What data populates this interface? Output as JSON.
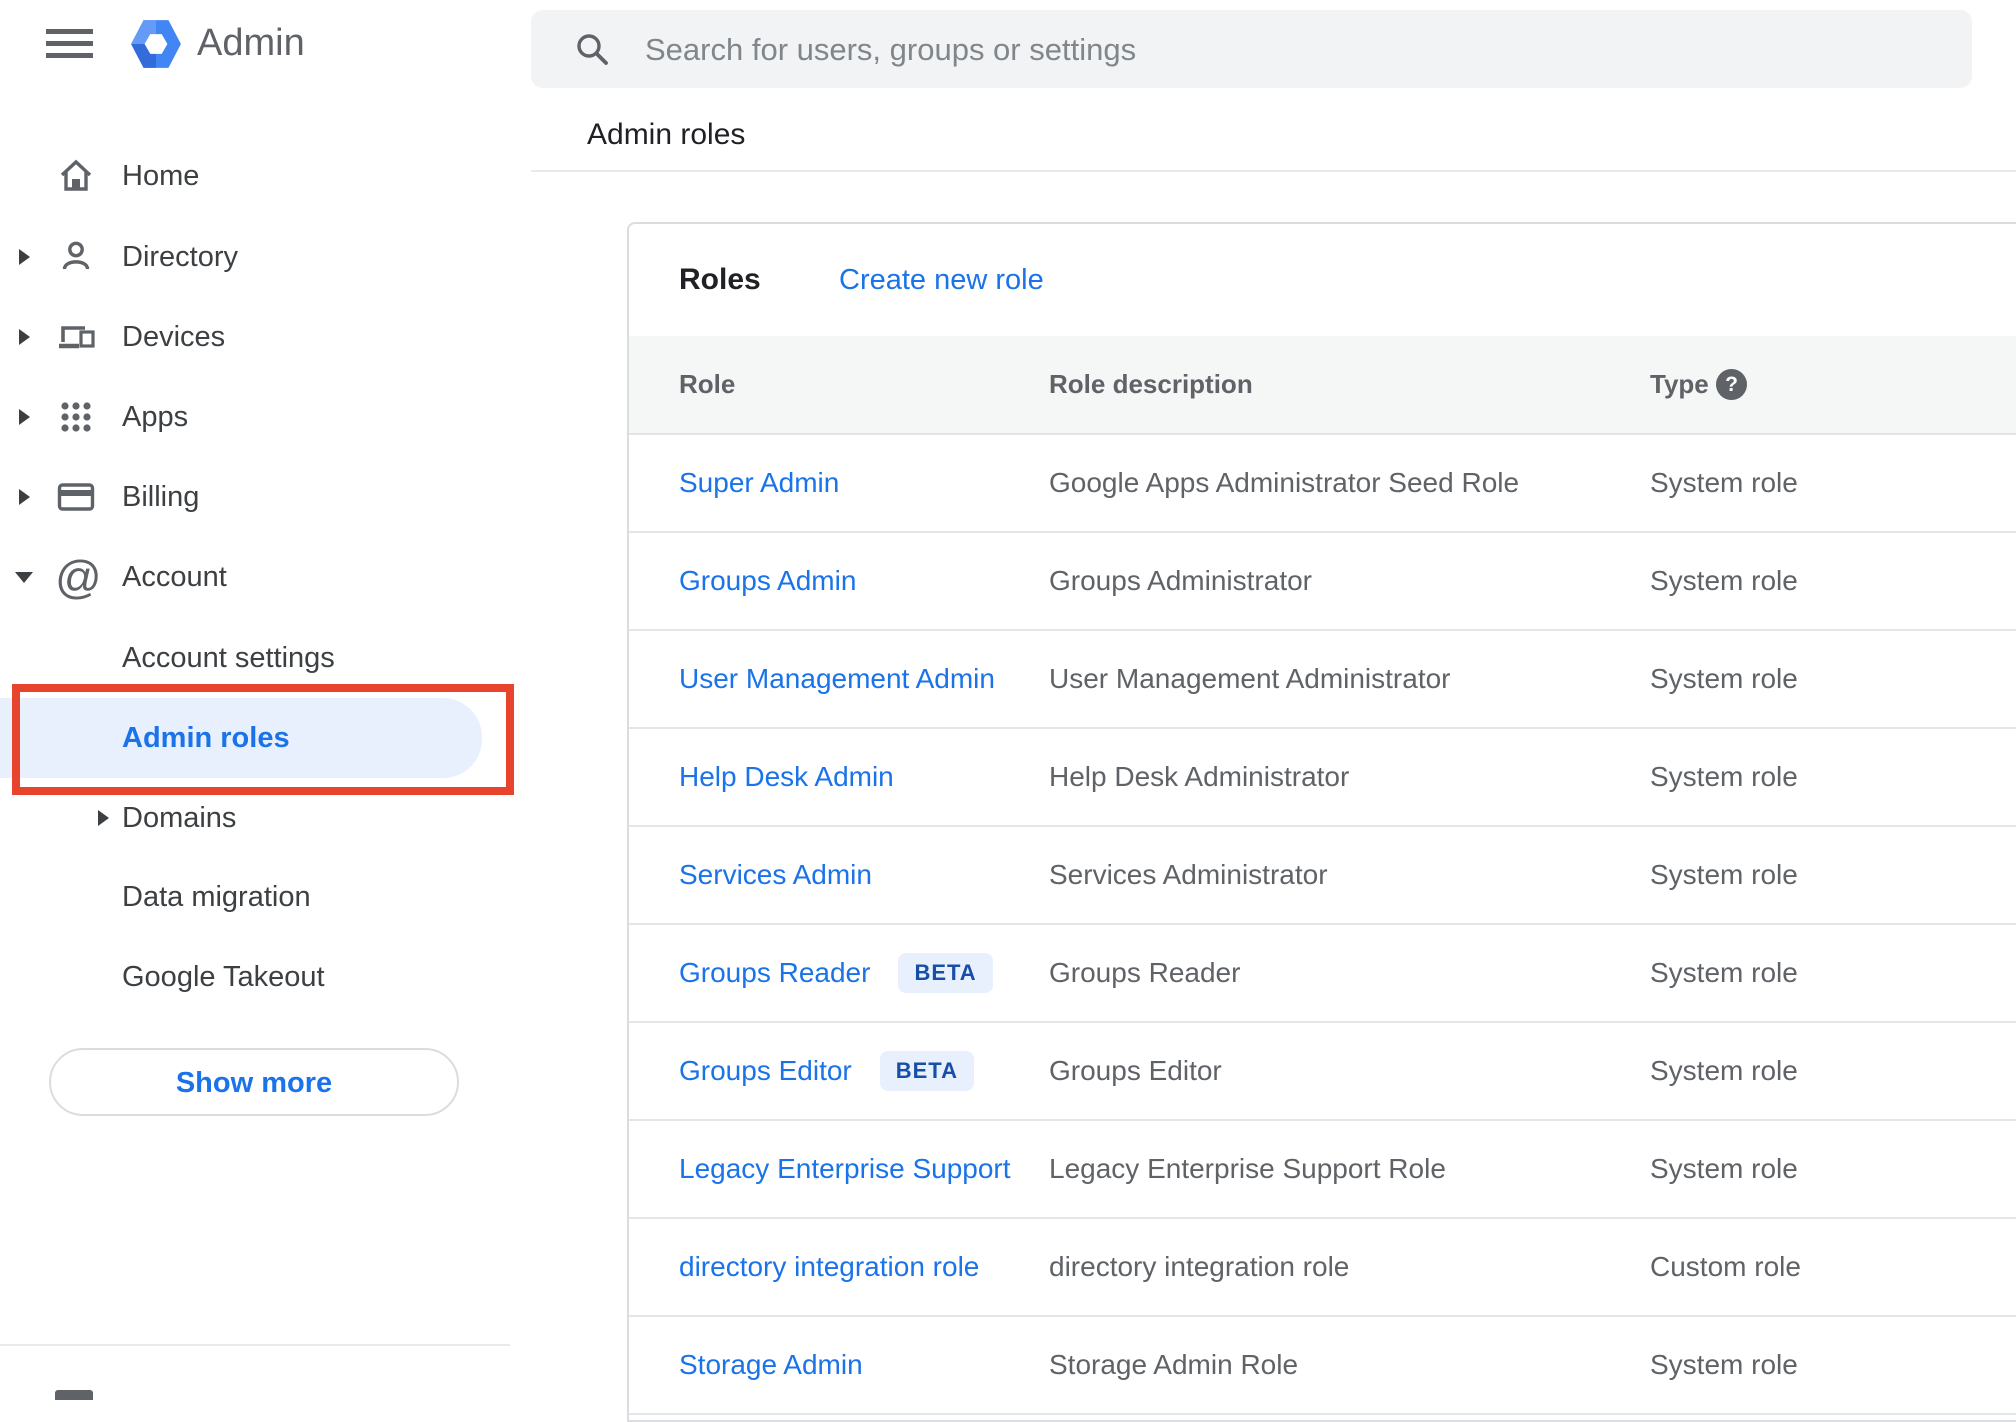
{
  "app": {
    "name": "Admin"
  },
  "search": {
    "placeholder": "Search for users, groups or settings"
  },
  "breadcrumb": "Admin roles",
  "sidebar": {
    "items": [
      {
        "label": "Home",
        "expandable": false
      },
      {
        "label": "Directory",
        "expandable": true
      },
      {
        "label": "Devices",
        "expandable": true
      },
      {
        "label": "Apps",
        "expandable": true
      },
      {
        "label": "Billing",
        "expandable": true
      },
      {
        "label": "Account",
        "expandable": true,
        "expanded": true
      }
    ],
    "account_children": [
      {
        "label": "Account settings",
        "selected": false
      },
      {
        "label": "Admin roles",
        "selected": true
      },
      {
        "label": "Domains",
        "expandable": true,
        "selected": false
      },
      {
        "label": "Data migration",
        "selected": false
      },
      {
        "label": "Google Takeout",
        "selected": false
      }
    ],
    "show_more_label": "Show more"
  },
  "main": {
    "card_title": "Roles",
    "create_link": "Create new role",
    "table": {
      "columns": [
        "Role",
        "Role description",
        "Type"
      ],
      "rows": [
        {
          "role": "Super Admin",
          "badge": "",
          "description": "Google Apps Administrator Seed Role",
          "type": "System role"
        },
        {
          "role": "Groups Admin",
          "badge": "",
          "description": "Groups Administrator",
          "type": "System role"
        },
        {
          "role": "User Management Admin",
          "badge": "",
          "description": "User Management Administrator",
          "type": "System role"
        },
        {
          "role": "Help Desk Admin",
          "badge": "",
          "description": "Help Desk Administrator",
          "type": "System role"
        },
        {
          "role": "Services Admin",
          "badge": "",
          "description": "Services Administrator",
          "type": "System role"
        },
        {
          "role": "Groups Reader",
          "badge": "BETA",
          "description": "Groups Reader",
          "type": "System role"
        },
        {
          "role": "Groups Editor",
          "badge": "BETA",
          "description": "Groups Editor",
          "type": "System role"
        },
        {
          "role": "Legacy Enterprise Support",
          "badge": "",
          "description": "Legacy Enterprise Support Role",
          "type": "System role"
        },
        {
          "role": "directory integration role",
          "badge": "",
          "description": "directory integration role",
          "type": "Custom role"
        },
        {
          "role": "Storage Admin",
          "badge": "",
          "description": "Storage Admin Role",
          "type": "System role"
        }
      ]
    }
  },
  "icons": {
    "menu": "hamburger",
    "logo": "admin-hexagon",
    "search": "magnifier",
    "help_glyph": "?",
    "account_glyph": "@",
    "expand": "triangle-right",
    "collapse": "triangle-down"
  },
  "colors": {
    "accent_blue": "#1a73e8",
    "selected_bg": "#e8f0fe",
    "annotation_red": "#e8432c",
    "badge_text": "#174ea6",
    "text_primary": "#202124",
    "text_secondary": "#5f6368",
    "search_bg": "#f1f3f4",
    "divider": "#e3e6e8"
  }
}
